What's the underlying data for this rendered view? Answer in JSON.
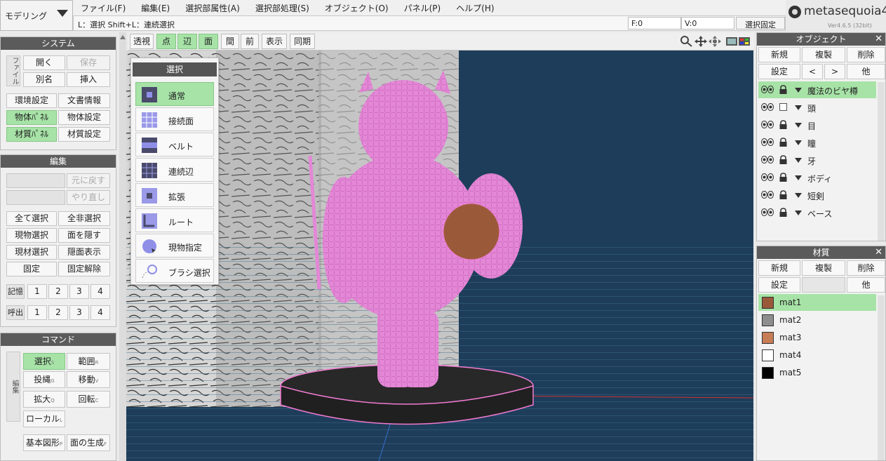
{
  "mode": {
    "label": "モデリング"
  },
  "menu": [
    "ファイル(F)",
    "編集(E)",
    "選択部属性(A)",
    "選択部処理(S)",
    "オブジェクト(O)",
    "パネル(P)",
    "ヘルプ(H)"
  ],
  "status": {
    "hint": "L：選択  Shift+L：連続選択",
    "face_count": "F:0",
    "vertex_count": "V:0",
    "fix_label": "選択固定"
  },
  "logo": {
    "brand": "metasequoia",
    "version_digit": "4",
    "version": "Ver4.6.5 (32bit)"
  },
  "system_panel": {
    "title": "システム",
    "file_label": "ファイル",
    "open": "開く",
    "save": "保存",
    "save_as": "別名",
    "insert": "挿入",
    "env": "環境設定",
    "doc_info": "文書情報",
    "obj_panel": "物体ﾊﾟﾈﾙ",
    "obj_settings": "物体設定",
    "mat_panel": "材質ﾊﾟﾈﾙ",
    "mat_settings": "材質設定"
  },
  "edit_panel": {
    "title": "編集",
    "undo": "元に戻す",
    "redo": "やり直し",
    "select_all": "全て選択",
    "deselect_all": "全非選択",
    "select_current_obj": "現物選択",
    "hide_face": "面を隠す",
    "select_current_mat": "現材選択",
    "show_hidden": "隠面表示",
    "lock": "固定",
    "unlock": "固定解除",
    "memory_label": "記憶",
    "recall_label": "呼出",
    "slots": [
      "1",
      "2",
      "3",
      "4"
    ]
  },
  "command_panel": {
    "title": "コマンド",
    "group_label": "編集",
    "select": "選択",
    "select_key": "S",
    "range": "範囲",
    "range_key": "R",
    "lasso": "投縄",
    "lasso_key": "G",
    "move": "移動",
    "move_key": "V",
    "scale": "拡大",
    "scale_key": "Q",
    "rotate": "回転",
    "rotate_key": "C",
    "local": "ローカル",
    "local_key": "L",
    "primitive": "基本図形",
    "primitive_key": "P",
    "make_face": "面の生成",
    "make_face_key": "F"
  },
  "toolbar": {
    "persp": "透視",
    "vertex": "点",
    "edge": "辺",
    "face": "面",
    "between": "間",
    "front": "前",
    "display": "表示",
    "sync": "同期"
  },
  "select_popup": {
    "title": "選択",
    "items": [
      "通常",
      "接続面",
      "ベルト",
      "連続辺",
      "拡張",
      "ルート",
      "現物指定",
      "ブラシ選択"
    ]
  },
  "object_panel": {
    "title": "オブジェクト",
    "new": "新規",
    "copy": "複製",
    "delete": "削除",
    "settings": "設定",
    "prev": "<",
    "next": ">",
    "other": "他",
    "objects": [
      "魔法のビヤ樽",
      "頭",
      "目",
      "瞳",
      "牙",
      "ボディ",
      "短剣",
      "ベース"
    ]
  },
  "material_panel": {
    "title": "材質",
    "new": "新規",
    "copy": "複製",
    "delete": "削除",
    "settings": "設定",
    "other": "他",
    "materials": [
      {
        "name": "mat1",
        "color": "#9a5a3a"
      },
      {
        "name": "mat2",
        "color": "#8e8e8e"
      },
      {
        "name": "mat3",
        "color": "#c77d55"
      },
      {
        "name": "mat4",
        "color": "#ffffff"
      },
      {
        "name": "mat5",
        "color": "#000000"
      }
    ]
  },
  "colors": {
    "accent_green": "#a7e3a7",
    "wire_pink": "#f07ad2",
    "viewport_bg": "#1e3d5a"
  }
}
